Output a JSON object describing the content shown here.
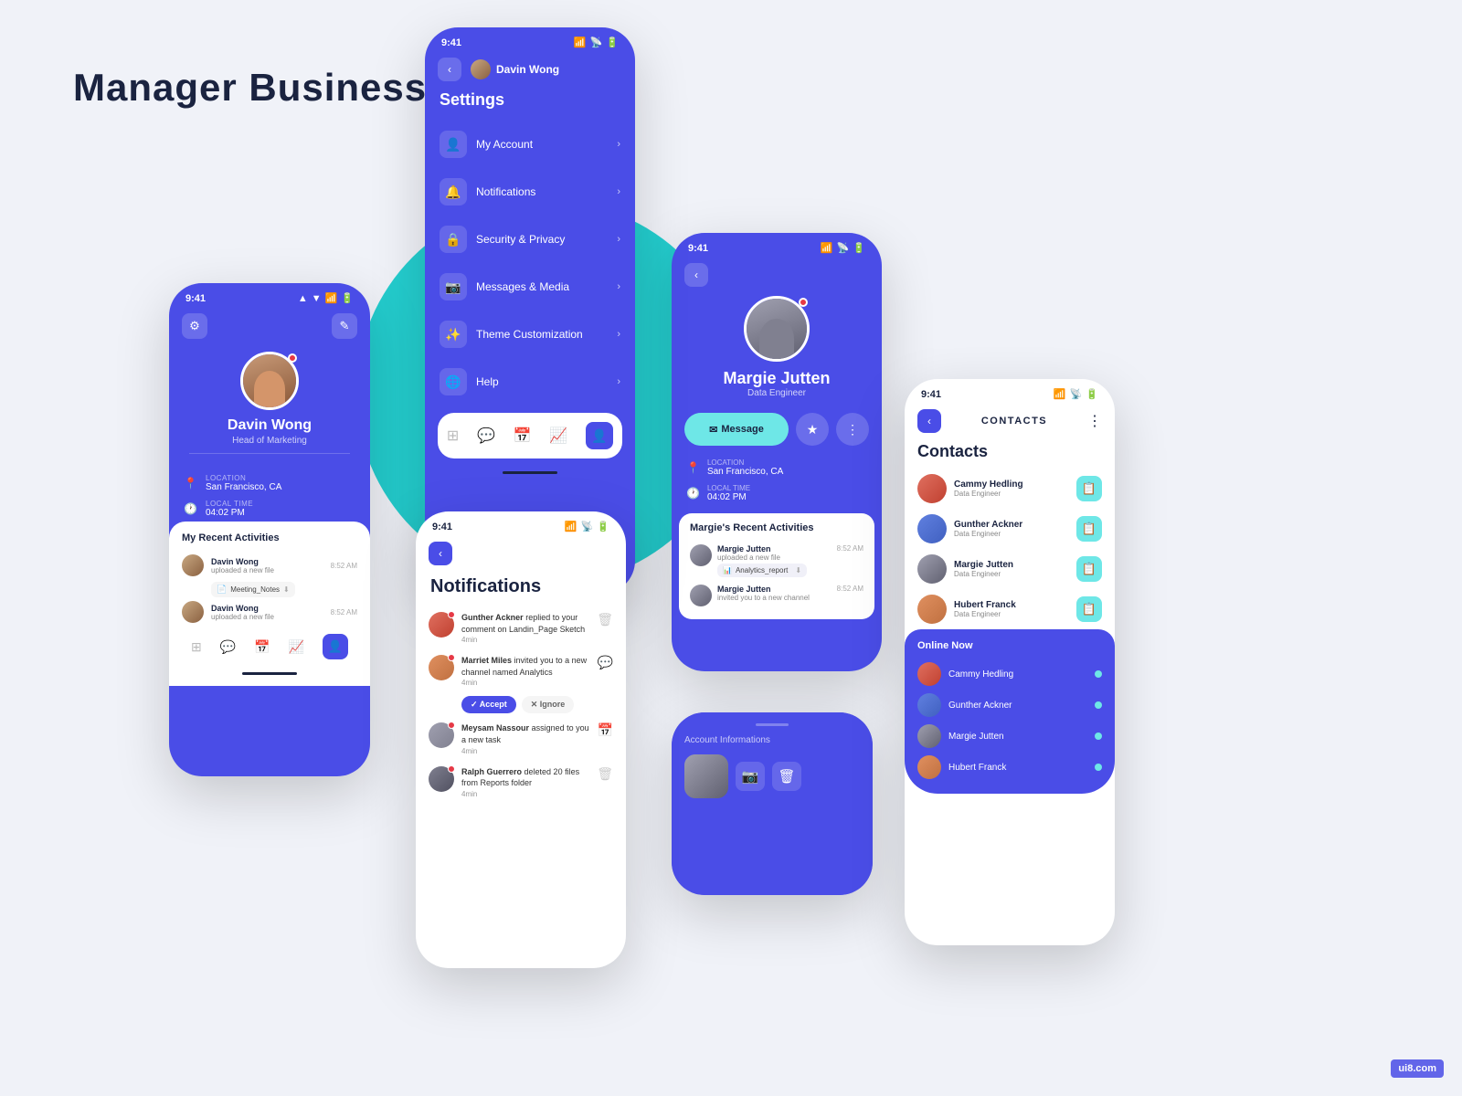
{
  "page": {
    "title": "Manager  Business",
    "background": "#f0f2f8",
    "watermark": "ui8.com"
  },
  "phone1": {
    "status_time": "9:41",
    "user_name": "Davin Wong",
    "user_title": "Head of Marketing",
    "location_label": "LOCATION",
    "location_value": "San Francisco, CA",
    "time_label": "LOCAL TIME",
    "time_value": "04:02 PM",
    "section_title": "My Recent Activities",
    "activities": [
      {
        "name": "Davin Wong",
        "action": "uploaded a new file",
        "time": "8:52 AM",
        "file": "Meeting_Notes"
      },
      {
        "name": "Davin Wong",
        "action": "uploaded a new file",
        "time": "8:52 AM"
      }
    ]
  },
  "phone2": {
    "status_time": "9:41",
    "header_name": "Davin Wong",
    "section_title": "Settings",
    "items": [
      {
        "label": "My Account",
        "icon": "👤"
      },
      {
        "label": "Notifications",
        "icon": "🔔"
      },
      {
        "label": "Security & Privacy",
        "icon": "🔒"
      },
      {
        "label": "Messages & Media",
        "icon": "📷"
      },
      {
        "label": "Theme Customization",
        "icon": "✨"
      },
      {
        "label": "Help",
        "icon": "🌐"
      }
    ]
  },
  "phone3": {
    "status_time": "9:41",
    "section_title": "Notifications",
    "notifications": [
      {
        "name": "Gunther Ackner",
        "action": "replied to your comment on Landin_Page Sketch",
        "time": "4min",
        "avatar_color": "red"
      },
      {
        "name": "Marriet Miles",
        "action": "invited you to a new channel named Analytics",
        "time": "4min",
        "avatar_color": "orange",
        "has_actions": true
      },
      {
        "name": "Meysam Nassour",
        "action": "assigned to you a new task",
        "time": "4min",
        "avatar_color": "gray"
      },
      {
        "name": "Ralph Guerrero",
        "action": "deleted 20 files from Reports folder",
        "time": "4min",
        "avatar_color": "dark"
      }
    ],
    "btn_accept": "✓ Accept",
    "btn_ignore": "✕ Ignore"
  },
  "phone4": {
    "status_time": "9:41",
    "user_name": "Margie Jutten",
    "user_title": "Data Engineer",
    "btn_message": "Message",
    "location_label": "LOCATION",
    "location_value": "San Francisco, CA",
    "time_label": "LOCAL TIME",
    "time_value": "04:02 PM",
    "section_title": "Margie's Recent Activities",
    "activities": [
      {
        "name": "Margie Jutten",
        "action": "uploaded a new file",
        "time": "8:52 AM",
        "file": "Analytics_report"
      },
      {
        "name": "Margie Jutten",
        "action": "invited you to a new channel",
        "time": "8:52 AM"
      }
    ]
  },
  "phone5": {
    "status_time": "9:41",
    "card_title": "Account Informations"
  },
  "phone6": {
    "status_time": "9:41",
    "header_title": "CONTACTS",
    "section_title": "Contacts",
    "contacts": [
      {
        "name": "Cammy Hedling",
        "role": "Data Engineer",
        "color": "red"
      },
      {
        "name": "Gunther Ackner",
        "role": "Data Engineer",
        "color": "blue"
      },
      {
        "name": "Margie Jutten",
        "role": "Data Engineer",
        "color": "teal"
      },
      {
        "name": "Hubert Franck",
        "role": "Data Engineer",
        "color": "orange"
      }
    ],
    "online_title": "Online Now",
    "online_users": [
      {
        "name": "Cammy Hedling",
        "color": "red"
      },
      {
        "name": "Gunther Ackner",
        "color": "blue2"
      },
      {
        "name": "Margie Jutten",
        "color": "teal2"
      },
      {
        "name": "Hubert Franck",
        "color": "orange2"
      }
    ]
  }
}
